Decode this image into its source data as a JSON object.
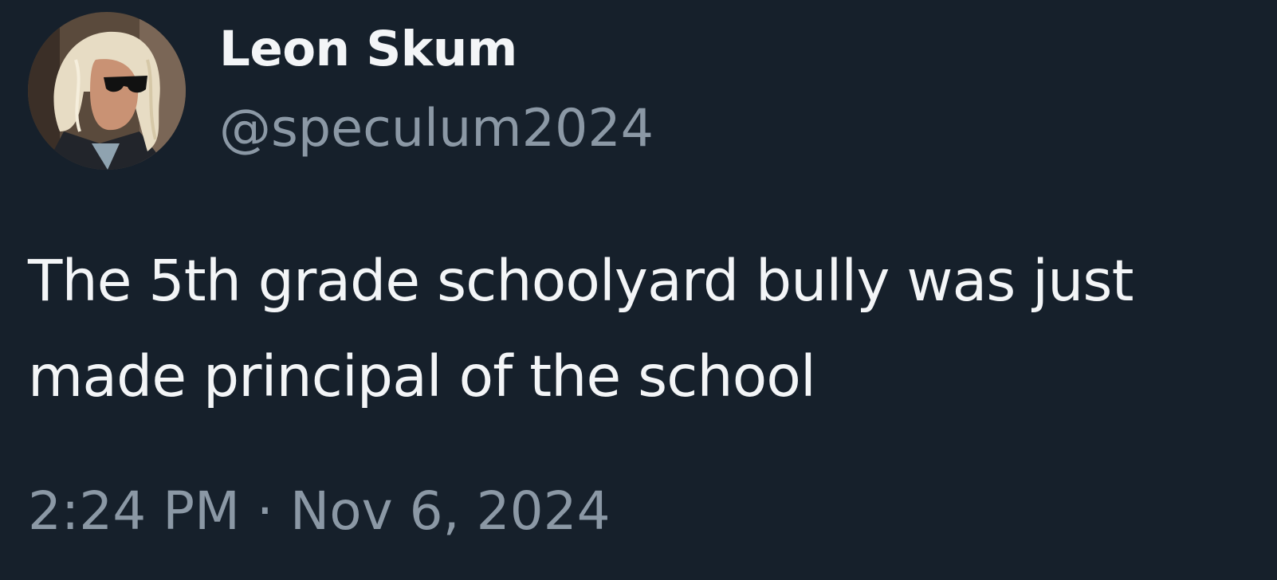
{
  "tweet": {
    "author": {
      "display_name": "Leon Skum",
      "handle": "@speculum2024"
    },
    "text_lines": [
      "The 5th grade schoolyard bully was just",
      "made principal of the school"
    ],
    "timestamp": "2:24 PM · Nov 6, 2024"
  },
  "colors": {
    "background": "#16202b",
    "primary_text": "#f3f5f7",
    "secondary_text": "#8b98a5"
  }
}
